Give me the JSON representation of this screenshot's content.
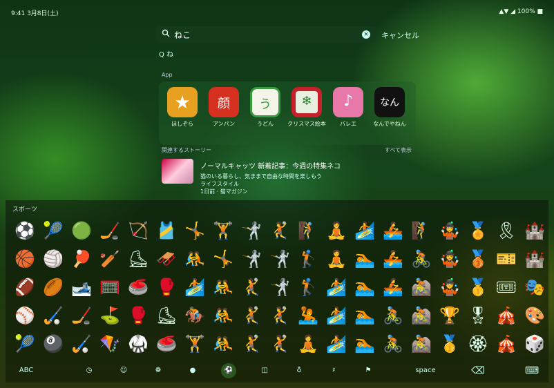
{
  "status_bar": {
    "time": "9:41 3月8日(土)",
    "right": "▲▼ ◢ 100% ■"
  },
  "search": {
    "query": "ねこ",
    "clear_glyph": "×",
    "cancel_label": "キャンセル"
  },
  "suggestion": {
    "text": "Q ね"
  },
  "apps_section": {
    "header": "App",
    "apps": [
      {
        "label": "ほしぞら",
        "bg": "#e8a020",
        "glyph": "★"
      },
      {
        "label": "アンパン",
        "bg": "#d63020",
        "glyph": "顔"
      },
      {
        "label": "うどん",
        "bg": "#3a9a40",
        "glyph": "う"
      },
      {
        "label": "クリスマス絵本",
        "bg": "#c8202a",
        "glyph": "❄"
      },
      {
        "label": "バレエ",
        "bg": "#e878a8",
        "glyph": "♪"
      },
      {
        "label": "なんでやねん",
        "bg": "#111111",
        "glyph": "なん"
      }
    ]
  },
  "stories": {
    "header": "関連するストーリー",
    "more": "すべて表示",
    "items": [
      {
        "title": "ノーマルキャッツ 新着記事：今週の特集ネコ",
        "lines": [
          "猫のいる暮らし、気ままで自由な時間を楽しもう",
          "ライフスタイル",
          "1日前 · 猫マガジン"
        ]
      }
    ]
  },
  "keyboard": {
    "category": "スポーツ",
    "rows": [
      [
        "⚽",
        "🎾",
        "🟢",
        "🏒",
        "🏹",
        "🎽",
        "🤸",
        "🏋",
        "🤺",
        "🤾",
        "🧗",
        "🧘",
        "🏄",
        "🚣",
        "🧗",
        "🤹",
        "🏅",
        "🎗",
        "🏰"
      ],
      [
        "🏀",
        "🏐",
        "🏓",
        "🏏",
        "⛸",
        "🛷",
        "🤼",
        "🤸",
        "🤺",
        "🤺",
        "🏌",
        "🧘",
        "🏊",
        "🚣",
        "🚴",
        "🤹",
        "🥉",
        "🎫",
        "🏰"
      ],
      [
        "🏈",
        "🏉",
        "🎿",
        "🥅",
        "🥌",
        "🥊",
        "🏄",
        "🤼",
        "🤾",
        "🤺",
        "🏌",
        "🏄",
        "🏊",
        "🚣",
        "🚵",
        "🤹",
        "🥇",
        "🎟",
        "🎭"
      ],
      [
        "⚾",
        "🏑",
        "🏒",
        "⛳",
        "🥊",
        "⛸",
        "🏇",
        "🤼",
        "🤾",
        "🤾",
        "🤽",
        "🏄",
        "🏊",
        "🚴",
        "🚵",
        "🏆",
        "🎖",
        "🎪",
        "🎨"
      ],
      [
        "🎾",
        "🎱",
        "🏑",
        "🪁",
        "🥋",
        "🥌",
        "🏋",
        "🤼",
        "🤾",
        "🤾",
        "🧘",
        "🏄",
        "🏊",
        "🚴",
        "🚵",
        "🥇",
        "🏵",
        "🎪",
        "🎲"
      ]
    ],
    "bar": {
      "abc": "ABC",
      "recent_icon": "clock-icon",
      "smileys_icon": "smiley-icon",
      "animals_icon": "bear-icon",
      "food_icon": "apple-icon",
      "activity_icon": "ball-icon",
      "travel_icon": "car-icon",
      "objects_icon": "bulb-icon",
      "symbols_icon": "symbols-icon",
      "flags_icon": "flag-icon",
      "space": "space",
      "delete_glyph": "⌫",
      "hide_glyph": "⌨"
    }
  },
  "colors": {
    "accent": "#2a8a2a",
    "selected_category_bg": "#3f8a3f"
  }
}
